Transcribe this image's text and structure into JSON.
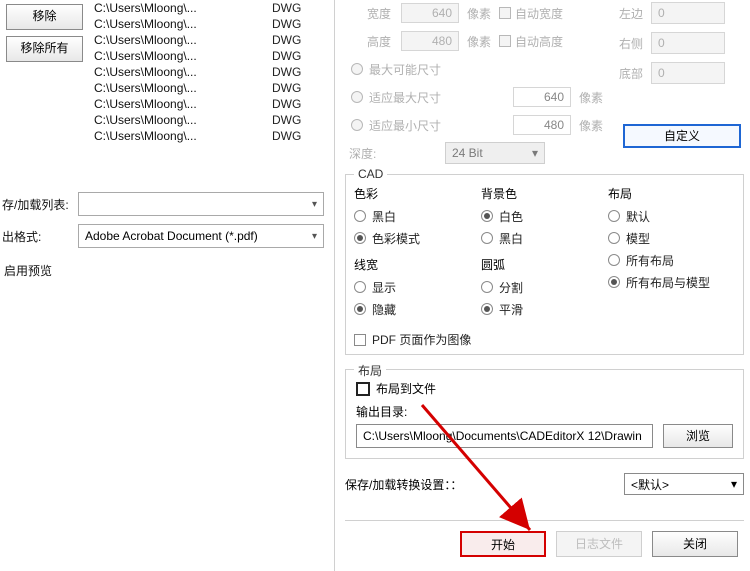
{
  "left": {
    "remove": "移除",
    "remove_all": "移除所有",
    "files": [
      {
        "path": "C:\\Users\\Mloong\\...",
        "type": "DWG"
      },
      {
        "path": "C:\\Users\\Mloong\\...",
        "type": "DWG"
      },
      {
        "path": "C:\\Users\\Mloong\\...",
        "type": "DWG"
      },
      {
        "path": "C:\\Users\\Mloong\\...",
        "type": "DWG"
      },
      {
        "path": "C:\\Users\\Mloong\\...",
        "type": "DWG"
      },
      {
        "path": "C:\\Users\\Mloong\\...",
        "type": "DWG"
      },
      {
        "path": "C:\\Users\\Mloong\\...",
        "type": "DWG"
      },
      {
        "path": "C:\\Users\\Mloong\\...",
        "type": "DWG"
      },
      {
        "path": "C:\\Users\\Mloong\\...",
        "type": "DWG"
      }
    ],
    "save_load_list": "存/加载列表:",
    "out_format": "出格式:",
    "format_value": "Adobe Acrobat Document (*.pdf)",
    "enable_preview": "启用预览"
  },
  "dims": {
    "width_lbl": "宽度",
    "width_val": "640",
    "height_lbl": "高度",
    "height_val": "480",
    "px": "像素",
    "auto_w": "自动宽度",
    "auto_h": "自动高度",
    "max_possible": "最大可能尺寸",
    "fit_max": "适应最大尺寸",
    "fit_max_val": "640",
    "fit_min": "适应最小尺寸",
    "fit_min_val": "480",
    "depth_lbl": "深度:",
    "depth_val": "24 Bit"
  },
  "margins": {
    "left_lbl": "左边",
    "left_val": "0",
    "right_lbl": "右侧",
    "right_val": "0",
    "bottom_lbl": "底部",
    "bottom_val": "0",
    "custom_btn": "自定义"
  },
  "cad": {
    "group_title": "CAD",
    "color_title": "色彩",
    "color_bw": "黑白",
    "color_mode": "色彩模式",
    "bg_title": "背景色",
    "bg_white": "白色",
    "bg_black": "黑白",
    "layout_title": "布局",
    "layout_default": "默认",
    "layout_model": "模型",
    "layout_all": "所有布局",
    "layout_all_model": "所有布局与模型",
    "line_title": "线宽",
    "line_show": "显示",
    "line_hide": "隐藏",
    "arc_title": "圆弧",
    "arc_split": "分割",
    "arc_smooth": "平滑",
    "pdf_as_image": "PDF 页面作为图像"
  },
  "layout": {
    "group_title": "布局",
    "to_file": "布局到文件",
    "out_dir_label": "输出目录:",
    "out_dir_value": "C:\\Users\\Mloong\\Documents\\CADEditorX 12\\Drawin",
    "browse": "浏览"
  },
  "save": {
    "label": "保存/加载转换设置：：",
    "value": "<默认>"
  },
  "bottom": {
    "start": "开始",
    "log": "日志文件",
    "close": "关闭"
  }
}
